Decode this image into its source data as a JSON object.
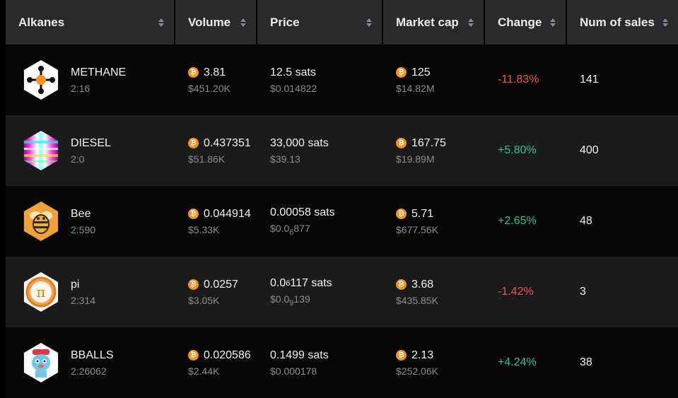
{
  "columns": [
    "Alkanes",
    "Volume",
    "Price",
    "Market cap",
    "Change",
    "Num of sales"
  ],
  "colors": {
    "up": "#2ec48b",
    "down": "#f0535d",
    "btc": "#f7931a"
  },
  "rows": [
    {
      "name": "METHANE",
      "id": "2:16",
      "icon": "methane-molecule-icon",
      "volume_btc": "3.81",
      "volume_usd": "$451.20K",
      "price": "12.5 sats",
      "price_usd": "$0.014822",
      "mcap_btc": "125",
      "mcap_usd": "$14.82M",
      "change": "-11.83%",
      "sales": "141"
    },
    {
      "name": "DIESEL",
      "id": "2:0",
      "icon": "diesel-glitch-icon",
      "volume_btc": "0.437351",
      "volume_usd": "$51.86K",
      "price": "33,000 sats",
      "price_usd": "$39.13",
      "mcap_btc": "167.75",
      "mcap_usd": "$19.89M",
      "change": "+5.80%",
      "sales": "400"
    },
    {
      "name": "Bee",
      "id": "2:590",
      "icon": "bee-icon",
      "volume_btc": "0.044914",
      "volume_usd": "$5.33K",
      "price": "0.00058 sats",
      "price_usd_pre": "$0.0",
      "price_usd_zeros": "6",
      "price_usd_post": "877",
      "mcap_btc": "5.71",
      "mcap_usd": "$677.56K",
      "change": "+2.65%",
      "sales": "48"
    },
    {
      "name": "pi",
      "id": "2:314",
      "icon": "pi-coin-icon",
      "volume_btc": "0.0257",
      "volume_usd": "$3.05K",
      "price_pre": "0.0",
      "price_zeros": "6",
      "price_post": "117 sats",
      "price_usd_pre": "$0.0",
      "price_usd_zeros": "9",
      "price_usd_post": "139",
      "mcap_btc": "3.68",
      "mcap_usd": "$435.85K",
      "change": "-1.42%",
      "sales": "3"
    },
    {
      "name": "BBALLS",
      "id": "2:26062",
      "icon": "bballs-character-icon",
      "volume_btc": "0.020586",
      "volume_usd": "$2.44K",
      "price": "0.1499 sats",
      "price_usd": "$0.000178",
      "mcap_btc": "2.13",
      "mcap_usd": "$252.06K",
      "change": "+4.24%",
      "sales": "38"
    }
  ]
}
